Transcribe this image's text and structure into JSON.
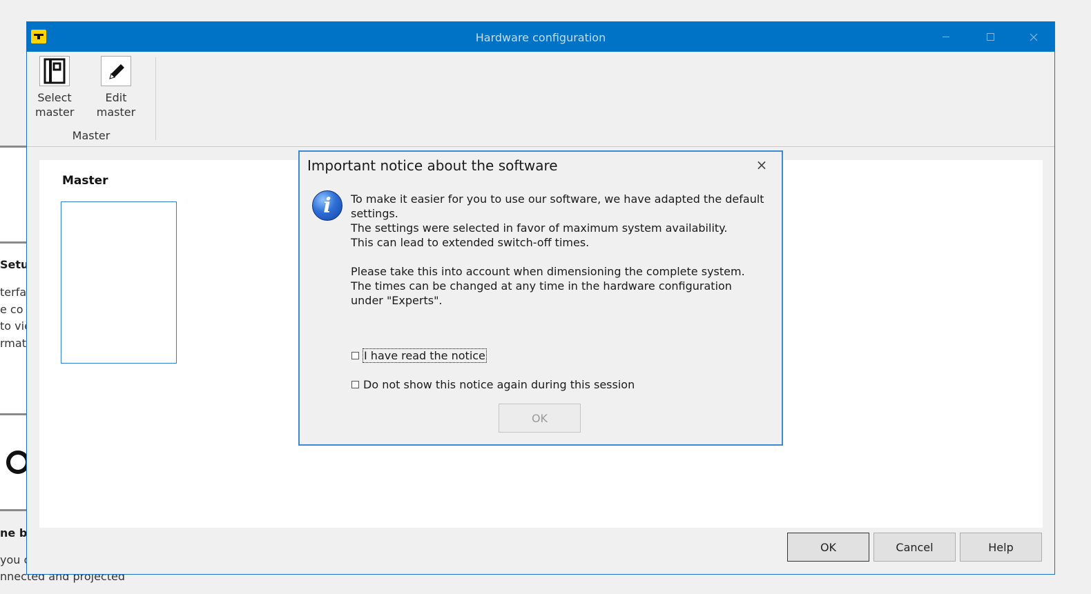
{
  "window": {
    "title": "Hardware configuration"
  },
  "ribbon": {
    "select_master_line1": "Select",
    "select_master_line2": "master",
    "edit_master_label": "Edit master",
    "group_label": "Master"
  },
  "content": {
    "master_heading": "Master"
  },
  "buttons": {
    "ok": "OK",
    "cancel": "Cancel",
    "help": "Help"
  },
  "dialog": {
    "title": "Important notice about the software",
    "close_glyph": "×",
    "info_glyph": "i",
    "paragraph1_line1": "To make it easier for you to use our software, we have adapted the default settings.",
    "paragraph1_line2": "The settings were selected in favor of maximum system availability.",
    "paragraph1_line3": "This can lead to extended switch-off times.",
    "paragraph2_line1": "Please take this into account when dimensioning the complete system.",
    "paragraph2_line2": "The times can be changed at any time in the hardware configuration under \"Experts\".",
    "checkbox_read_label": "I have read the notice",
    "checkbox_read_checked": false,
    "checkbox_session_label": "Do not show this notice again during this session",
    "checkbox_session_checked": false,
    "ok_label": "OK",
    "ok_enabled": false
  },
  "background": {
    "setup_fragment": "Setu",
    "line1": "terfa",
    "line2": "e co",
    "line3": "to vie",
    "line4": "rmati",
    "heading2_fragment": "ne bu",
    "line5": "you c",
    "bottom_line": "nnected and projected"
  }
}
